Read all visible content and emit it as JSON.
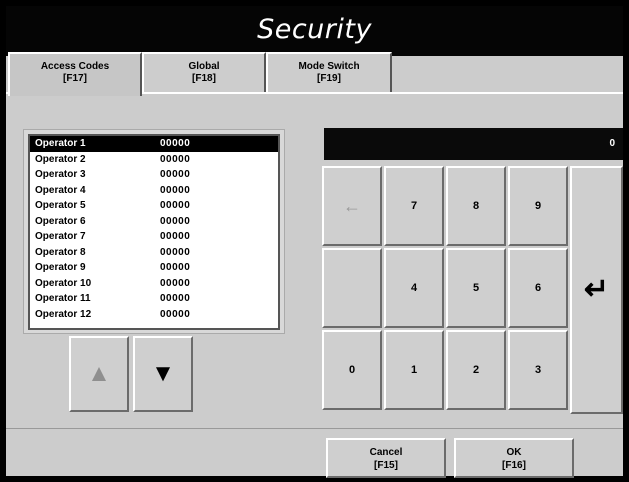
{
  "window": {
    "title": "Security"
  },
  "tabs": [
    {
      "label": "Access Codes",
      "key": "[F17]"
    },
    {
      "label": "Global",
      "key": "[F18]"
    },
    {
      "label": "Mode Switch",
      "key": "[F19]"
    }
  ],
  "operators": [
    {
      "name": "Operator 1",
      "code": "00000"
    },
    {
      "name": "Operator 2",
      "code": "00000"
    },
    {
      "name": "Operator 3",
      "code": "00000"
    },
    {
      "name": "Operator 4",
      "code": "00000"
    },
    {
      "name": "Operator 5",
      "code": "00000"
    },
    {
      "name": "Operator 6",
      "code": "00000"
    },
    {
      "name": "Operator 7",
      "code": "00000"
    },
    {
      "name": "Operator 8",
      "code": "00000"
    },
    {
      "name": "Operator 9",
      "code": "00000"
    },
    {
      "name": "Operator 10",
      "code": "00000"
    },
    {
      "name": "Operator 11",
      "code": "00000"
    },
    {
      "name": "Operator 12",
      "code": "00000"
    }
  ],
  "selected_operator": "Operator 1",
  "scroll": {
    "up_glyph": "▲",
    "down_glyph": "▼"
  },
  "display": {
    "value": "0"
  },
  "keypad": {
    "backspace": "←",
    "k7": "7",
    "k8": "8",
    "k9": "9",
    "k4": "4",
    "k5": "5",
    "k6": "6",
    "k0": "0",
    "k1": "1",
    "k2": "2",
    "k3": "3",
    "enter": "↵"
  },
  "actions": {
    "cancel": {
      "label": "Cancel",
      "key": "[F15]"
    },
    "ok": {
      "label": "OK",
      "key": "[F16]"
    }
  },
  "colors": {
    "background": "#cccccc",
    "titlebar": "#050505",
    "selected_row": "#000000"
  }
}
